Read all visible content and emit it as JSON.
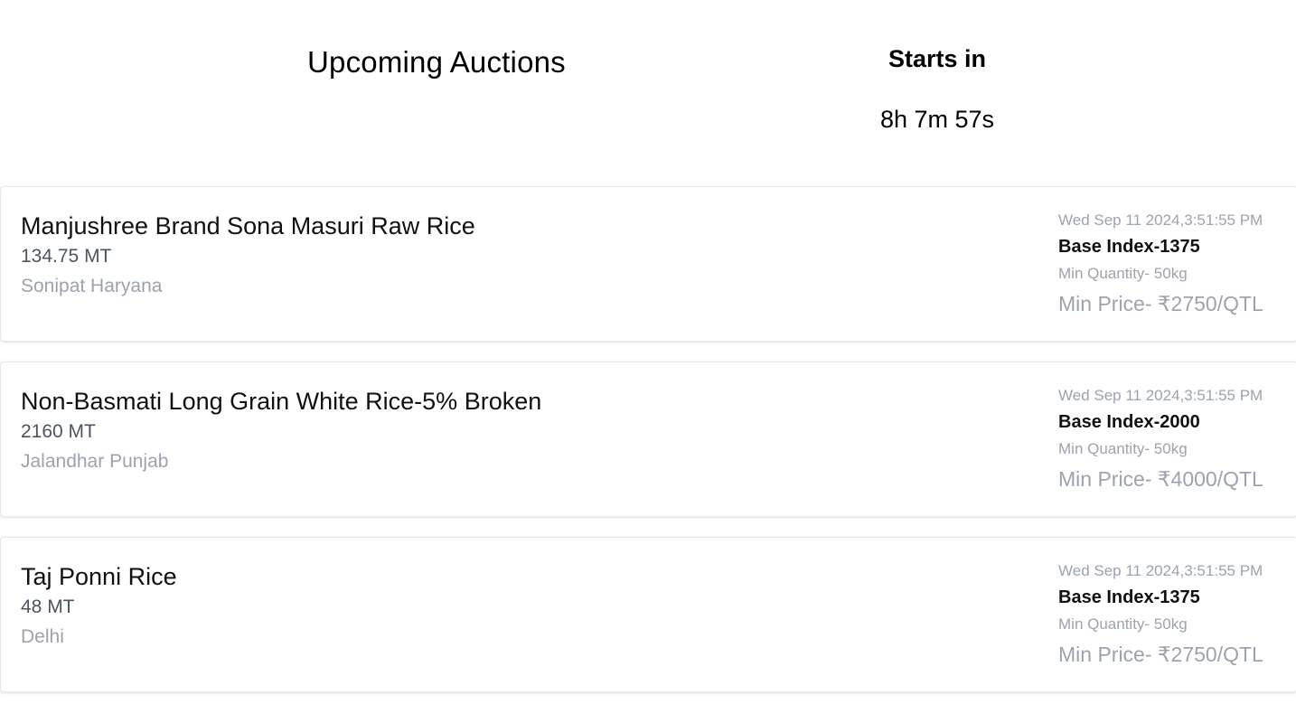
{
  "header": {
    "title": "Upcoming Auctions",
    "countdown_label": "Starts in",
    "countdown_value": "8h 7m 57s"
  },
  "auctions": [
    {
      "name": "Manjushree Brand Sona Masuri Raw Rice",
      "quantity": "134.75 MT",
      "location": "Sonipat Haryana",
      "date": "Wed Sep 11 2024,3:51:55 PM",
      "base_index": "Base Index-1375",
      "min_quantity": "Min Quantity- 50kg",
      "min_price": "Min Price- ₹2750/QTL"
    },
    {
      "name": "Non-Basmati Long Grain White Rice-5% Broken",
      "quantity": "2160 MT",
      "location": "Jalandhar Punjab",
      "date": "Wed Sep 11 2024,3:51:55 PM",
      "base_index": "Base Index-2000",
      "min_quantity": "Min Quantity- 50kg",
      "min_price": "Min Price- ₹4000/QTL"
    },
    {
      "name": "Taj Ponni Rice",
      "quantity": "48 MT",
      "location": "Delhi",
      "date": "Wed Sep 11 2024,3:51:55 PM",
      "base_index": "Base Index-1375",
      "min_quantity": "Min Quantity- 50kg",
      "min_price": "Min Price- ₹2750/QTL"
    }
  ]
}
